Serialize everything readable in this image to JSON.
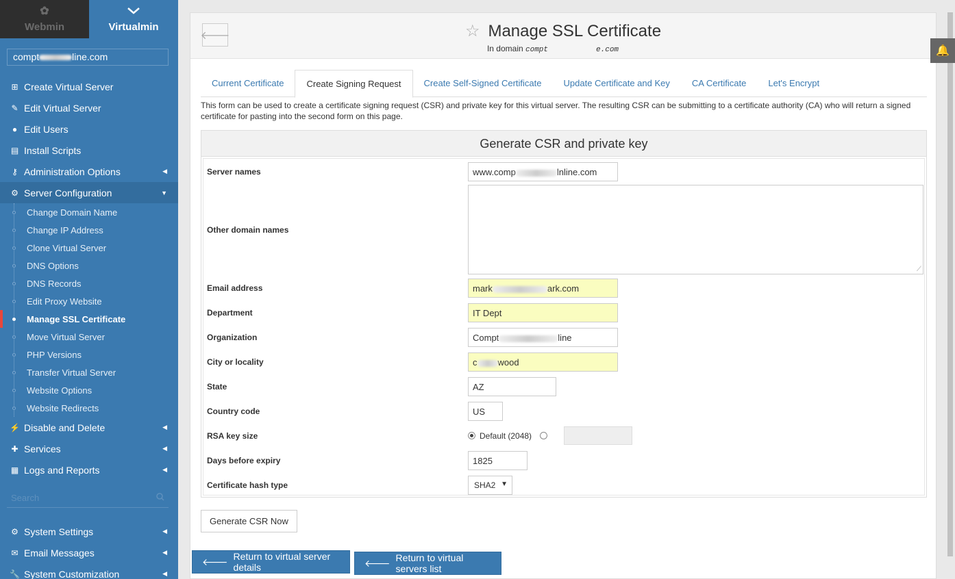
{
  "sidebar": {
    "webmin_label": "Webmin",
    "virtualmin_label": "Virtualmin",
    "domain_prefix": "compt",
    "domain_suffix": "line.com",
    "menu": [
      {
        "label": "Create Virtual Server",
        "icon": "plus-square-icon"
      },
      {
        "label": "Edit Virtual Server",
        "icon": "edit-icon"
      },
      {
        "label": "Edit Users",
        "icon": "users-icon"
      },
      {
        "label": "Install Scripts",
        "icon": "archive-icon"
      },
      {
        "label": "Administration Options",
        "icon": "key-icon"
      },
      {
        "label": "Server Configuration",
        "icon": "cogs-icon"
      }
    ],
    "submenu": [
      "Change Domain Name",
      "Change IP Address",
      "Clone Virtual Server",
      "DNS Options",
      "DNS Records",
      "Edit Proxy Website",
      "Manage SSL Certificate",
      "Move Virtual Server",
      "PHP Versions",
      "Transfer Virtual Server",
      "Website Options",
      "Website Redirects"
    ],
    "menu_after": [
      {
        "label": "Disable and Delete",
        "icon": "plug-icon"
      },
      {
        "label": "Services",
        "icon": "puzzle-icon"
      },
      {
        "label": "Logs and Reports",
        "icon": "file-icon"
      }
    ],
    "search_placeholder": "Search",
    "menu_bottom": [
      {
        "label": "System Settings",
        "icon": "gear-icon"
      },
      {
        "label": "Email Messages",
        "icon": "envelope-icon"
      },
      {
        "label": "System Customization",
        "icon": "wrench-icon"
      }
    ]
  },
  "header": {
    "title": "Manage SSL Certificate",
    "subtitle_prefix": "In domain",
    "domain_start": "compt",
    "domain_end": "e.com"
  },
  "tabs": [
    "Current Certificate",
    "Create Signing Request",
    "Create Self-Signed Certificate",
    "Update Certificate and Key",
    "CA Certificate",
    "Let's Encrypt"
  ],
  "description": "This form can be used to create a certificate signing request (CSR) and private key for this virtual server. The resulting CSR can be submitting to a certificate authority (CA) who will return a signed certificate for pasting into the second form on this page.",
  "form": {
    "heading": "Generate CSR and private key",
    "labels": {
      "server_names": "Server names",
      "other_domains": "Other domain names",
      "email": "Email address",
      "department": "Department",
      "organization": "Organization",
      "city": "City or locality",
      "state": "State",
      "country": "Country code",
      "rsa": "RSA key size",
      "days": "Days before expiry",
      "hash": "Certificate hash type"
    },
    "values": {
      "server_names_a": "www.comp",
      "server_names_b": "lnline.com",
      "email_a": "mark",
      "email_b": "ark.com",
      "department": "IT Dept",
      "organization_a": "Compt",
      "organization_b": "line",
      "city_a": "c",
      "city_b": "wood",
      "state": "AZ",
      "country": "US",
      "rsa_default": "Default (2048)",
      "days": "1825",
      "hash": "SHA2"
    }
  },
  "buttons": {
    "generate": "Generate CSR Now",
    "return_details": "Return to virtual server details",
    "return_list": "Return to virtual servers list"
  }
}
